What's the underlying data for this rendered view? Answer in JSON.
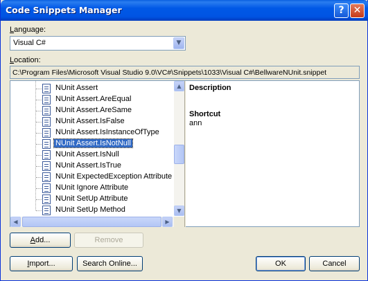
{
  "window": {
    "title": "Code Snippets Manager"
  },
  "titlebar": {
    "help_glyph": "?",
    "close_glyph": "✕"
  },
  "language": {
    "label_underlined": "L",
    "label_rest": "anguage:",
    "value": "Visual C#"
  },
  "location": {
    "label_underlined": "L",
    "label_rest": "ocation:",
    "value": "C:\\Program Files\\Microsoft Visual Studio 9.0\\VC#\\Snippets\\1033\\Visual C#\\BellwareNUnit.snippet"
  },
  "tree": {
    "items": [
      "NUnit Assert",
      "NUnit Assert.AreEqual",
      "NUnit Assert.AreSame",
      "NUnit Assert.IsFalse",
      "NUnit Assert.IsInstanceOfType",
      "NUnit Assert.IsNotNull",
      "NUnit Assert.IsNull",
      "NUnit Assert.IsTrue",
      "NUnit ExpectedException Attribute",
      "NUnit Ignore Attribute",
      "NUnit SetUp Attribute",
      "NUnit SetUp Method"
    ],
    "selected_label": "NUnit Assert.IsNotNull"
  },
  "details": {
    "description_heading": "Description",
    "shortcut_heading": "Shortcut",
    "shortcut_value": "ann"
  },
  "buttons": {
    "add_underlined": "A",
    "add_rest": "dd...",
    "remove": "Remove",
    "import_underlined": "I",
    "import_rest": "mport...",
    "search_online": "Search Online...",
    "ok": "OK",
    "cancel": "Cancel"
  },
  "icons": {
    "snippet_item": "snippet-document-icon",
    "dropdown": "chevron-down-icon",
    "scroll_up": "arrow-up-icon",
    "scroll_down": "arrow-down-icon",
    "scroll_left": "arrow-left-icon",
    "scroll_right": "arrow-right-icon"
  },
  "colors": {
    "title_bar": "#0054e3",
    "selection": "#316ac5",
    "dialog_bg": "#ece9d8"
  }
}
